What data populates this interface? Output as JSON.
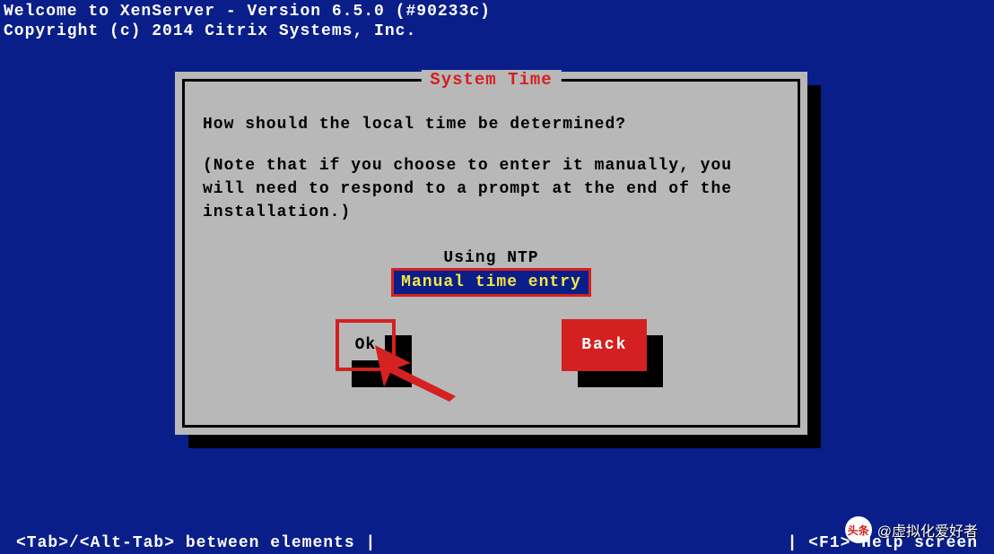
{
  "header": {
    "line1": "Welcome to XenServer - Version 6.5.0 (#90233c)",
    "line2": "Copyright (c) 2014 Citrix Systems, Inc."
  },
  "dialog": {
    "title": "System Time",
    "question": "How should the local time be determined?",
    "note": "(Note that if you choose to enter it manually, you will need to respond to a prompt at the end of the installation.)",
    "options": {
      "ntp": "Using NTP",
      "manual": "Manual time entry"
    },
    "buttons": {
      "ok": "Ok",
      "back": "Back"
    }
  },
  "footer": {
    "left": "<Tab>/<Alt-Tab> between elements   |",
    "right": "|  <F1> Help screen"
  },
  "watermark": {
    "brand": "头条",
    "user": "@虚拟化爱好者"
  }
}
